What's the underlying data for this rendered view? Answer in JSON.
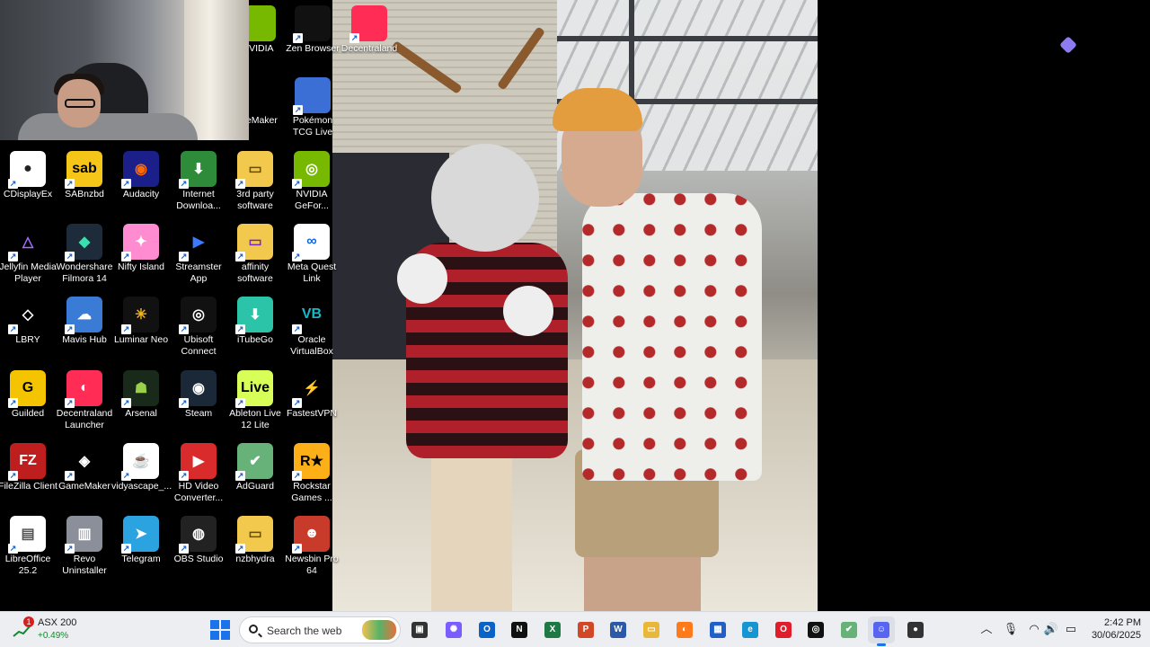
{
  "desktop": {
    "top_icons": [
      {
        "label": "NVIDIA",
        "icon": "nvidia-app-icon",
        "color": "#76b900"
      },
      {
        "label": "Zen Browser",
        "icon": "zen-browser-icon",
        "color": "#111111"
      },
      {
        "label": "Decentraland",
        "icon": "decentraland-icon",
        "color": "#ff2d55"
      },
      {
        "label": "meMaker",
        "icon": "gamemaker-icon",
        "color": "#000000"
      },
      {
        "label": "Pokémon TCG Live",
        "icon": "pokemon-tcg-icon",
        "color": "#3b6fd6"
      }
    ],
    "icons": [
      {
        "label": "CDisplayEx",
        "icon": "speech-bubble-icon",
        "color": "#ffffff",
        "text_color": "#222222",
        "glyph": "●"
      },
      {
        "label": "SABnzbd",
        "icon": "sabnzbd-icon",
        "color": "#f5c518",
        "text_color": "#000000",
        "glyph": "sab"
      },
      {
        "label": "Audacity",
        "icon": "audacity-icon",
        "color": "#1b1f8a",
        "text_color": "#ff6a00",
        "glyph": "◉"
      },
      {
        "label": "Internet Downloa...",
        "icon": "internet-download-icon",
        "color": "#2e8b3a",
        "text_color": "#ffffff",
        "glyph": "⬇"
      },
      {
        "label": "3rd party software",
        "icon": "folder-icon",
        "color": "#f2c94c",
        "text_color": "#6a4e00",
        "glyph": "▭"
      },
      {
        "label": "NVIDIA GeFor...",
        "icon": "nvidia-geforce-icon",
        "color": "#76b900",
        "text_color": "#ffffff",
        "glyph": "◎"
      },
      {
        "label": "Jellyfin Media Player",
        "icon": "jellyfin-icon",
        "color": "#000000",
        "text_color": "#a66cff",
        "glyph": "△"
      },
      {
        "label": "Wondershare Filmora 14",
        "icon": "filmora-icon",
        "color": "#1d2b3a",
        "text_color": "#38e0b0",
        "glyph": "◆"
      },
      {
        "label": "Nifty Island",
        "icon": "nifty-island-icon",
        "color": "#ff8bd1",
        "text_color": "#ffffff",
        "glyph": "✦"
      },
      {
        "label": "Streamster App",
        "icon": "streamster-icon",
        "color": "#000000",
        "text_color": "#3a7bff",
        "glyph": "▶"
      },
      {
        "label": "affinity software",
        "icon": "folder-icon",
        "color": "#f2c94c",
        "text_color": "#7a2bbd",
        "glyph": "▭"
      },
      {
        "label": "Meta Quest Link",
        "icon": "meta-icon",
        "color": "#ffffff",
        "text_color": "#0a66e8",
        "glyph": "∞"
      },
      {
        "label": "LBRY",
        "icon": "lbry-icon",
        "color": "#000000",
        "text_color": "#ffffff",
        "glyph": "◇"
      },
      {
        "label": "Mavis Hub",
        "icon": "mavis-hub-icon",
        "color": "#3a7bd5",
        "text_color": "#ffffff",
        "glyph": "☁"
      },
      {
        "label": "Luminar Neo",
        "icon": "luminar-neo-icon",
        "color": "#111111",
        "text_color": "#f5b21a",
        "glyph": "✳"
      },
      {
        "label": "Ubisoft Connect",
        "icon": "ubisoft-icon",
        "color": "#111111",
        "text_color": "#ffffff",
        "glyph": "◎"
      },
      {
        "label": "iTubeGo",
        "icon": "itubego-icon",
        "color": "#2bc4a8",
        "text_color": "#ffffff",
        "glyph": "⬇"
      },
      {
        "label": "Oracle VirtualBox",
        "icon": "virtualbox-icon",
        "color": "#000000",
        "text_color": "#18b7c9",
        "glyph": "VB"
      },
      {
        "label": "Guilded",
        "icon": "guilded-icon",
        "color": "#f5c400",
        "text_color": "#000000",
        "glyph": "G"
      },
      {
        "label": "Decentraland Launcher",
        "icon": "decentraland-icon",
        "color": "#ff2d55",
        "text_color": "#ffffff",
        "glyph": "◐"
      },
      {
        "label": "Arsenal",
        "icon": "arsenal-icon",
        "color": "#1a2a1a",
        "text_color": "#9ad04a",
        "glyph": "☗"
      },
      {
        "label": "Steam",
        "icon": "steam-icon",
        "color": "#1b2838",
        "text_color": "#ffffff",
        "glyph": "◉"
      },
      {
        "label": "Ableton Live 12 Lite",
        "icon": "ableton-icon",
        "color": "#d8ff57",
        "text_color": "#000000",
        "glyph": "Live"
      },
      {
        "label": "FastestVPN",
        "icon": "lightning-icon",
        "color": "#000000",
        "text_color": "#f5a623",
        "glyph": "⚡"
      },
      {
        "label": "FileZilla Client",
        "icon": "filezilla-icon",
        "color": "#bf1e1e",
        "text_color": "#ffffff",
        "glyph": "FZ"
      },
      {
        "label": "GameMaker",
        "icon": "gamemaker-icon",
        "color": "#000000",
        "text_color": "#ffffff",
        "glyph": "◈"
      },
      {
        "label": "vidyascape_...",
        "icon": "java-icon",
        "color": "#ffffff",
        "text_color": "#e76f00",
        "glyph": "☕"
      },
      {
        "label": "HD Video Converter...",
        "icon": "video-converter-icon",
        "color": "#d92b2b",
        "text_color": "#ffffff",
        "glyph": "▶"
      },
      {
        "label": "AdGuard",
        "icon": "adguard-icon",
        "color": "#67b279",
        "text_color": "#ffffff",
        "glyph": "✔"
      },
      {
        "label": "Rockstar Games ...",
        "icon": "rockstar-icon",
        "color": "#fcaf17",
        "text_color": "#000000",
        "glyph": "R★"
      },
      {
        "label": "LibreOffice 25.2",
        "icon": "document-icon",
        "color": "#ffffff",
        "text_color": "#555555",
        "glyph": "▤"
      },
      {
        "label": "Revo Uninstaller",
        "icon": "revo-uninstaller-icon",
        "color": "#8a8f99",
        "text_color": "#ffffff",
        "glyph": "▥"
      },
      {
        "label": "Telegram",
        "icon": "telegram-icon",
        "color": "#2aa3e0",
        "text_color": "#ffffff",
        "glyph": "➤"
      },
      {
        "label": "OBS Studio",
        "icon": "obs-icon",
        "color": "#222222",
        "text_color": "#ffffff",
        "glyph": "◍"
      },
      {
        "label": "nzbhydra",
        "icon": "folder-icon",
        "color": "#f2c94c",
        "text_color": "#6a4e00",
        "glyph": "▭"
      },
      {
        "label": "Newsbin Pro 64",
        "icon": "newsbin-icon",
        "color": "#c83a2a",
        "text_color": "#ffffff",
        "glyph": "☻"
      }
    ]
  },
  "taskbar": {
    "widget": {
      "badge": "1",
      "name": "ASX 200",
      "change": "+0.49%"
    },
    "search_placeholder": "Search the web",
    "apps": [
      {
        "name": "task-view",
        "icon": "task-view-icon",
        "color": "#333333",
        "glyph": "▣"
      },
      {
        "name": "copilot",
        "icon": "copilot-icon",
        "color": "#7b5cff",
        "glyph": "✺"
      },
      {
        "name": "outlook",
        "icon": "outlook-icon",
        "color": "#0a64c8",
        "glyph": "O"
      },
      {
        "name": "notion",
        "icon": "notion-icon",
        "color": "#111111",
        "glyph": "N"
      },
      {
        "name": "excel",
        "icon": "excel-icon",
        "color": "#1d7a44",
        "glyph": "X"
      },
      {
        "name": "powerpoint",
        "icon": "powerpoint-icon",
        "color": "#d24726",
        "glyph": "P"
      },
      {
        "name": "word",
        "icon": "word-icon",
        "color": "#2b5aa8",
        "glyph": "W"
      },
      {
        "name": "file-explorer",
        "icon": "folder-icon",
        "color": "#e9b83a",
        "glyph": "▭"
      },
      {
        "name": "firefox",
        "icon": "firefox-icon",
        "color": "#ff7a1a",
        "glyph": "◐"
      },
      {
        "name": "store",
        "icon": "store-icon",
        "color": "#2060c8",
        "glyph": "▦"
      },
      {
        "name": "edge",
        "icon": "edge-icon",
        "color": "#1595d1",
        "glyph": "e"
      },
      {
        "name": "opera",
        "icon": "opera-icon",
        "color": "#e11d2b",
        "glyph": "O"
      },
      {
        "name": "zen-browser",
        "icon": "zen-browser-icon",
        "color": "#111111",
        "glyph": "◎"
      },
      {
        "name": "adguard",
        "icon": "adguard-icon",
        "color": "#67b279",
        "glyph": "✔"
      },
      {
        "name": "discord",
        "icon": "discord-icon",
        "color": "#5865f2",
        "glyph": "☺"
      },
      {
        "name": "app-red",
        "icon": "notification-app-icon",
        "color": "#333333",
        "glyph": "●"
      }
    ],
    "tray": [
      "chevron-up-icon",
      "microphone-icon",
      "wifi-icon",
      "speaker-icon",
      "battery-icon"
    ],
    "time": "2:42 PM",
    "date": "30/06/2025"
  }
}
